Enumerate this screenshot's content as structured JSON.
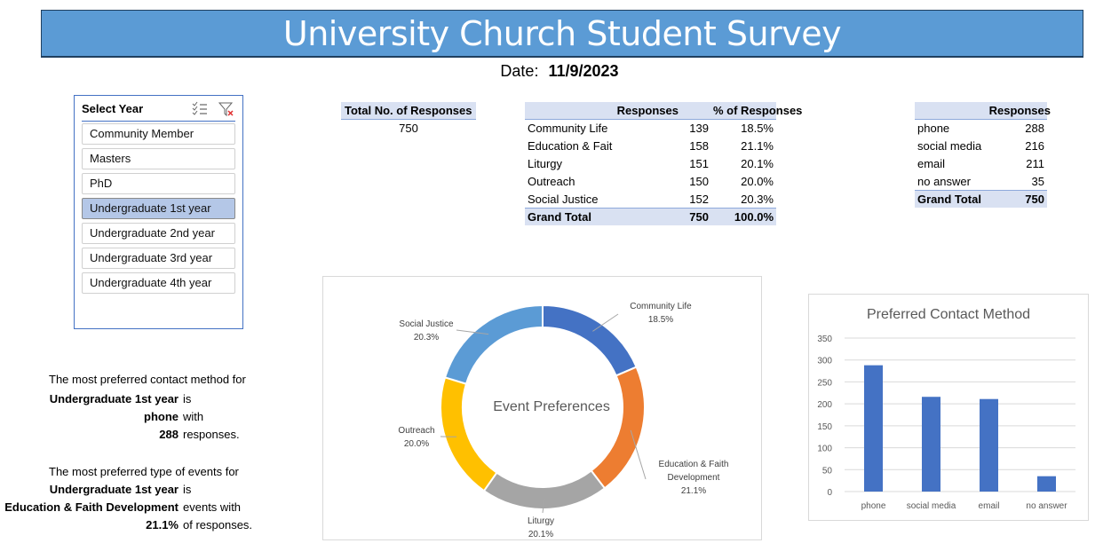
{
  "header": {
    "title": "University Church Student Survey",
    "date_label": "Date:",
    "date_value": "11/9/2023"
  },
  "slicer": {
    "title": "Select Year",
    "icons": [
      "multi-select-icon",
      "clear-filter-icon"
    ],
    "items": [
      {
        "label": "Community Member",
        "selected": false
      },
      {
        "label": "Masters",
        "selected": false
      },
      {
        "label": "PhD",
        "selected": false
      },
      {
        "label": "Undergraduate 1st year",
        "selected": true
      },
      {
        "label": "Undergraduate 2nd year",
        "selected": false
      },
      {
        "label": "Undergraduate 3rd year",
        "selected": false
      },
      {
        "label": "Undergraduate 4th year",
        "selected": false
      }
    ]
  },
  "total_table": {
    "header": "Total No. of Responses",
    "value": "750"
  },
  "events_table": {
    "headers": [
      "",
      "Responses",
      "% of Responses"
    ],
    "rows": [
      {
        "label": "Community Life",
        "responses": "139",
        "pct": "18.5%"
      },
      {
        "label": "Education & Fait",
        "responses": "158",
        "pct": "21.1%"
      },
      {
        "label": "Liturgy",
        "responses": "151",
        "pct": "20.1%"
      },
      {
        "label": "Outreach",
        "responses": "150",
        "pct": "20.0%"
      },
      {
        "label": "Social Justice",
        "responses": "152",
        "pct": "20.3%"
      }
    ],
    "total": {
      "label": "Grand Total",
      "responses": "750",
      "pct": "100.0%"
    }
  },
  "contact_table": {
    "headers": [
      "",
      "Responses"
    ],
    "rows": [
      {
        "label": "phone",
        "responses": "288"
      },
      {
        "label": "social media",
        "responses": "216"
      },
      {
        "label": "email",
        "responses": "211"
      },
      {
        "label": "no answer",
        "responses": "35"
      }
    ],
    "total": {
      "label": "Grand Total",
      "responses": "750"
    }
  },
  "summary": {
    "contact": {
      "line1": "The  most preferred contact method for",
      "group": "Undergraduate 1st year",
      "is": "is",
      "method": "phone",
      "with": "with",
      "count": "288",
      "responses": "responses."
    },
    "events": {
      "line1": "The most preferred type of events for",
      "group": "Undergraduate 1st year",
      "is": "is",
      "event": "Education & Faith Development",
      "events_with": "events with",
      "pct": "21.1%",
      "of_responses": "of responses."
    }
  },
  "chart_data": [
    {
      "type": "pie",
      "variant": "donut",
      "title": "Event Preferences",
      "categories": [
        "Community Life",
        "Education & Faith Development",
        "Liturgy",
        "Outreach",
        "Social Justice"
      ],
      "values": [
        139,
        158,
        151,
        150,
        152
      ],
      "labels": [
        "18.5%",
        "21.1%",
        "20.1%",
        "20.0%",
        "20.3%"
      ],
      "colors": [
        "#4472c4",
        "#ed7d31",
        "#a5a5a5",
        "#ffc000",
        "#5b9bd5"
      ],
      "legend": "none"
    },
    {
      "type": "bar",
      "title": "Preferred Contact Method",
      "categories": [
        "phone",
        "social media",
        "email",
        "no answer"
      ],
      "values": [
        288,
        216,
        211,
        35
      ],
      "xlabel": "",
      "ylabel": "",
      "ylim": [
        0,
        350
      ],
      "yticks": [
        0,
        50,
        100,
        150,
        200,
        250,
        300,
        350
      ],
      "grid": true,
      "color": "#4472c4"
    }
  ]
}
